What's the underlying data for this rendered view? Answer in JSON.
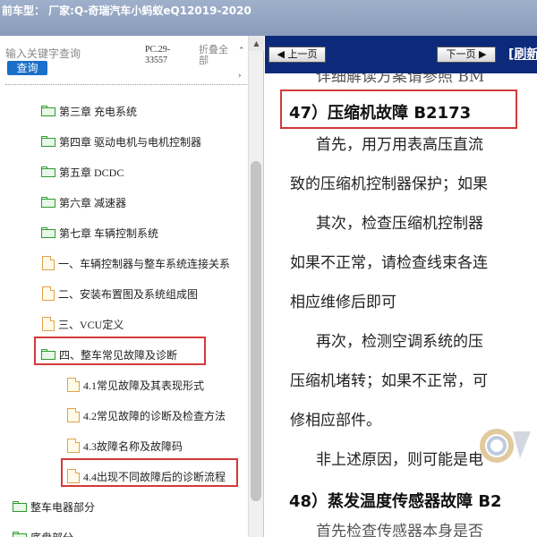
{
  "titlebar": {
    "text": "前车型：  厂家:Q-奇瑞汽车小蚂蚁eQ12019-2020"
  },
  "left_panel": {
    "search": {
      "placeholder": "输入关键字查询",
      "button_label": "查询"
    },
    "pc_code": "PC.29-33557",
    "collapse_all": "折叠全部",
    "tree": [
      {
        "label": "第三章 充电系统",
        "type": "folder"
      },
      {
        "label": "第四章 驱动电机与电机控制器",
        "type": "folder"
      },
      {
        "label": "第五章 DCDC",
        "type": "folder"
      },
      {
        "label": "第六章 减速器",
        "type": "folder"
      },
      {
        "label": "第七章 车辆控制系统",
        "type": "folder-open"
      },
      {
        "label": "一、车辆控制器与整车系统连接关系",
        "type": "doc"
      },
      {
        "label": "二、安装布置图及系统组成图",
        "type": "doc"
      },
      {
        "label": "三、VCU定义",
        "type": "doc"
      },
      {
        "label": "四、整车常见故障及诊断",
        "type": "folder-open"
      },
      {
        "label": "4.1常见故障及其表现形式",
        "type": "doc"
      },
      {
        "label": "4.2常见故障的诊断及检查方法",
        "type": "doc"
      },
      {
        "label": "4.3故障名称及故障码",
        "type": "doc"
      },
      {
        "label": "4.4出现不同故障后的诊断流程",
        "type": "doc"
      },
      {
        "label": "整车电器部分",
        "type": "folder"
      },
      {
        "label": "底盘部分",
        "type": "folder"
      }
    ]
  },
  "right_panel": {
    "prev_label": "上一页",
    "next_label": "下一页",
    "refresh_label": "[刷新",
    "content": {
      "top_cut": "详细解读方案请参照 BM",
      "heading1": "47）压缩机故障 B2173",
      "lines": [
        "首先，用万用表高压直流",
        "致的压缩机控制器保护；如果",
        "其次，检查压缩机控制器",
        "如果不正常，请检查线束各连",
        "相应维修后即可",
        "再次，检测空调系统的压",
        "压缩机堵转；如果不正常，可",
        "修相应部件。",
        "非上述原因，则可能是电"
      ],
      "heading2": "48）蒸发温度传感器故障 B2",
      "bottom_cut": "首先检查传感器本身是否"
    }
  }
}
